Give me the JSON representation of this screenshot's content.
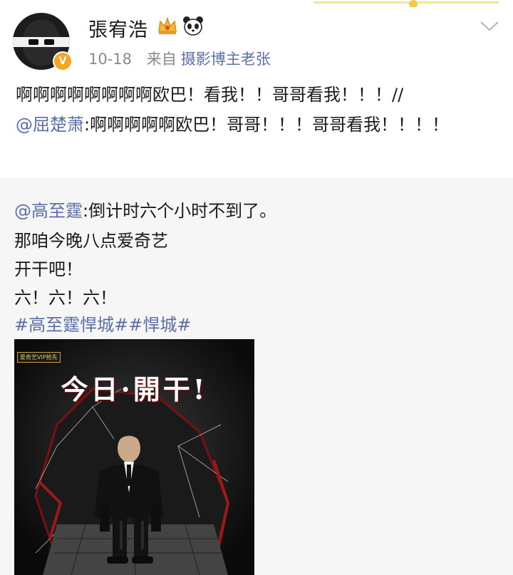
{
  "user": {
    "name": "張宥浩",
    "time": "10-18",
    "source_prefix": "来自",
    "source": "摄影博主老张",
    "verified_badge": "V"
  },
  "post": {
    "text": "啊啊啊啊啊啊啊啊欧巴！看我！！哥哥看我！！！//",
    "mention": "@屈楚萧",
    "text2": ":啊啊啊啊啊欧巴！哥哥！！！哥哥看我！！！！"
  },
  "repost": {
    "mention": "@高至霆",
    "line1": ":倒计时六个小时不到了。",
    "line2": "那咱今晚八点爱奇艺",
    "line3": "开干吧！",
    "line4": "六！六！六！",
    "hashtags": "#高至霆悍城##悍城#"
  },
  "poster": {
    "vip_tag": "爱奇艺VIP抢先",
    "headline": "今日·開干!"
  },
  "icons": {
    "crown": "crown-icon",
    "panda": "panda-icon",
    "chevron": "chevron-down-icon"
  },
  "colors": {
    "link": "#5b6fa6",
    "badge": "#f5a623",
    "quote_bg": "#f6f6f6"
  }
}
